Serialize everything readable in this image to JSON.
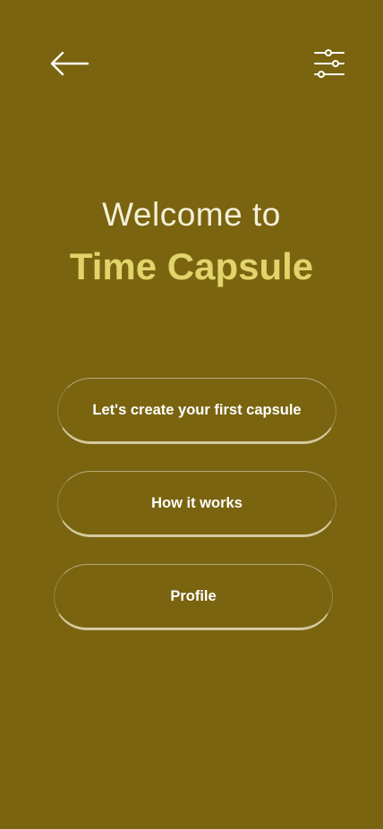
{
  "header": {
    "back_icon": "arrow-left-icon",
    "filter_icon": "sliders-icon"
  },
  "hero": {
    "welcome": "Welcome to",
    "app_name": "Time Capsule"
  },
  "actions": {
    "create_label": "Let's create your first capsule",
    "how_label": "How it works",
    "profile_label": "Profile"
  },
  "colors": {
    "background": "#7a6410",
    "accent": "#e1d46b",
    "text": "#ffffff"
  }
}
